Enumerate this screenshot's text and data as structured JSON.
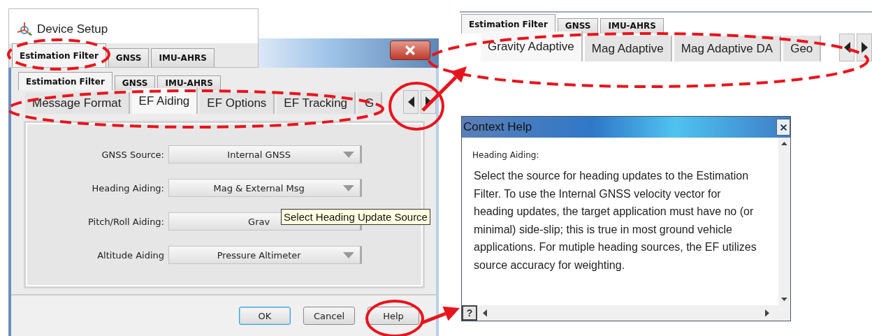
{
  "device_setup": {
    "title": "Device Setup",
    "header_tabs": [
      {
        "label": "Estimation Filter",
        "selected": true
      },
      {
        "label": "GNSS",
        "selected": false
      },
      {
        "label": "IMU-AHRS",
        "selected": false
      }
    ],
    "tabs": [
      {
        "label": "Estimation Filter",
        "selected": true
      },
      {
        "label": "GNSS",
        "selected": false
      },
      {
        "label": "IMU-AHRS",
        "selected": false
      }
    ],
    "subtabs": [
      {
        "label": "Message Format",
        "selected": false
      },
      {
        "label": "EF Aiding",
        "selected": true
      },
      {
        "label": "EF Options",
        "selected": false
      },
      {
        "label": "EF Tracking",
        "selected": false
      },
      {
        "label": "G",
        "selected": false
      }
    ],
    "fields": [
      {
        "label": "GNSS Source:",
        "value": "Internal GNSS"
      },
      {
        "label": "Heading Aiding:",
        "value": "Mag & External Msg"
      },
      {
        "label": "Pitch/Roll Aiding:",
        "value": "Grav"
      },
      {
        "label": "Altitude Aiding",
        "value": "Pressure Altimeter"
      }
    ],
    "tooltip": "Select Heading Update Source",
    "buttons": [
      {
        "label": "OK",
        "default": true
      },
      {
        "label": "Cancel",
        "default": false
      },
      {
        "label": "Help",
        "default": false
      }
    ]
  },
  "zoomed_tabs": {
    "tabs": [
      {
        "label": "Estimation Filter",
        "selected": true
      },
      {
        "label": "GNSS",
        "selected": false
      },
      {
        "label": "IMU-AHRS",
        "selected": false
      }
    ],
    "subtabs": [
      {
        "label": "Gravity Adaptive",
        "selected": true
      },
      {
        "label": "Mag Adaptive",
        "selected": false
      },
      {
        "label": "Mag Adaptive DA",
        "selected": false
      },
      {
        "label": "Geo",
        "selected": false
      }
    ]
  },
  "context_help": {
    "title": "Context Help",
    "heading": "Heading Aiding:",
    "body": "Select the source for heading updates to the Estimation Filter. To use the Internal GNSS velocity vector for heading updates, the target application must have no (or minimal) side-slip; this is true in most ground vehicle applications. For mutiple heading sources, the EF utilizes source accuracy for weighting.",
    "help_button": "?"
  }
}
